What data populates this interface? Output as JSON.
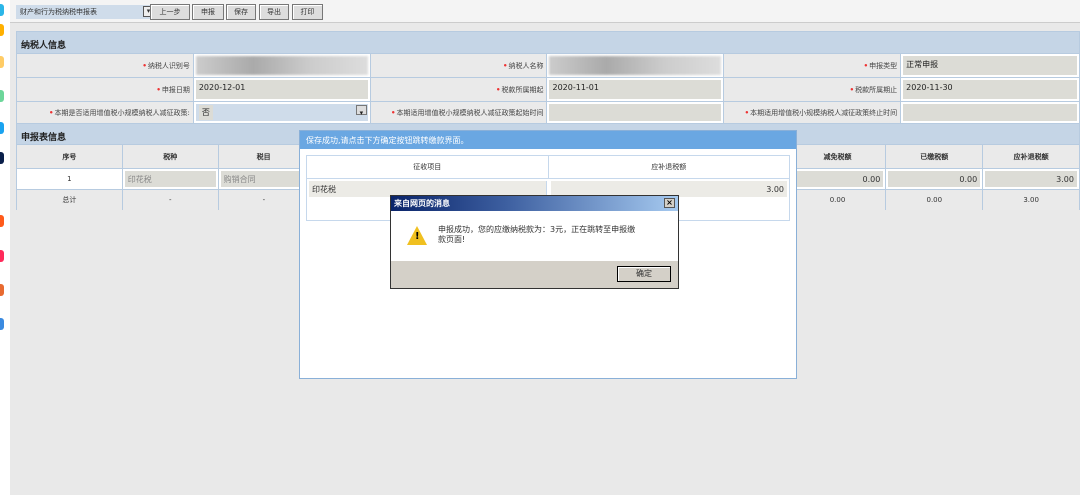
{
  "toolbar": {
    "form_select": "财产和行为税纳税申报表",
    "prev": "上一步",
    "submit": "申报",
    "save": "保存",
    "export": "导出",
    "print": "打印"
  },
  "taxpayer": {
    "title": "纳税人信息",
    "id_label": "纳税人识别号",
    "name_label": "纳税人名称",
    "type_label": "申报类型",
    "type_value": "正常申报",
    "date_label": "申报日期",
    "date_value": "2020-12-01",
    "period_start_label": "税款所属期起",
    "period_start_value": "2020-11-01",
    "period_end_label": "税款所属期止",
    "period_end_value": "2020-11-30",
    "small_label": "本期是否适用增值税小规模纳税人减征政策:",
    "small_value": "否",
    "small_start_label": "本期适用增值税小规模纳税人减征政策起始时间",
    "small_end_label": "本期适用增值税小规模纳税人减征政策终止时间"
  },
  "report": {
    "title": "申报表信息",
    "headers": [
      "序号",
      "税种",
      "税目",
      "减免税额",
      "已缴税额",
      "应补退税额"
    ],
    "row": [
      "1",
      "印花税",
      "购销合同",
      "0.00",
      "0.00",
      "3.00"
    ],
    "total": [
      "总计",
      "-",
      "-",
      "0.00",
      "0.00",
      "3.00"
    ]
  },
  "dialog": {
    "title": "保存成功,请点击下方确定按钮跳转缴款界面。",
    "headers": [
      "征收项目",
      "应补退税额"
    ],
    "row": [
      "印花税",
      "3.00"
    ]
  },
  "alert": {
    "title": "来自网页的消息",
    "message": "申报成功，您的应缴纳税款为：3元，正在跳转至申报缴款页面!",
    "ok": "确定"
  }
}
